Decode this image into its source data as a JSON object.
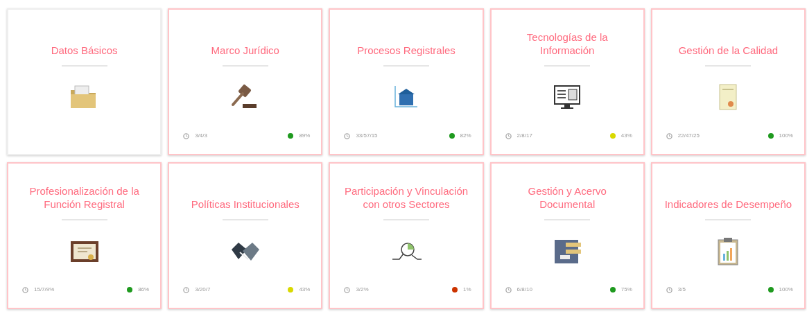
{
  "cards": [
    {
      "title": "Datos Básicos",
      "highlighted": false
    },
    {
      "title": "Marco Jurídico",
      "highlighted": true,
      "date": "3/4/3",
      "percent": "89%",
      "color": "#1f9a1f"
    },
    {
      "title": "Procesos Registrales",
      "highlighted": true,
      "date": "33/57/15",
      "percent": "82%",
      "color": "#1f9a1f"
    },
    {
      "title": "Tecnologías de la Información",
      "highlighted": true,
      "date": "2/8/17",
      "percent": "43%",
      "color": "#d9d900"
    },
    {
      "title": "Gestión de la Calidad",
      "highlighted": true,
      "date": "22/47/25",
      "percent": "100%",
      "color": "#1f9a1f"
    },
    {
      "title": "Profesionalización de la Función Registral",
      "highlighted": true,
      "date": "15/7/9%",
      "percent": "86%",
      "color": "#1f9a1f"
    },
    {
      "title": "Políticas Institucionales",
      "highlighted": true,
      "date": "3/20/7",
      "percent": "43%",
      "color": "#d9d900"
    },
    {
      "title": "Participación y Vinculación con otros Sectores",
      "highlighted": true,
      "date": "3/2%",
      "percent": "1%",
      "color": "#cc3300"
    },
    {
      "title": "Gestión y Acervo Documental",
      "highlighted": true,
      "date": "6/8/10",
      "percent": "75%",
      "color": "#1f9a1f"
    },
    {
      "title": "Indicadores de Desempeño",
      "highlighted": true,
      "date": "3/5",
      "percent": "100%",
      "color": "#1f9a1f"
    }
  ]
}
